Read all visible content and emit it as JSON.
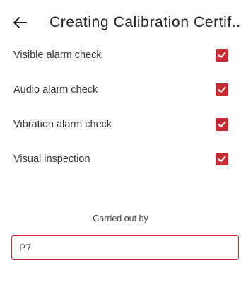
{
  "header": {
    "back_icon": "arrow-left-icon",
    "title": "Creating Calibration Certif..."
  },
  "checks": [
    {
      "label": "Visible alarm check",
      "checked": true
    },
    {
      "label": "Audio alarm check",
      "checked": true
    },
    {
      "label": "Vibration alarm check",
      "checked": true
    },
    {
      "label": "Visual inspection",
      "checked": true
    }
  ],
  "carried_out_by": {
    "label": "Carried out by",
    "value": "P7"
  },
  "colors": {
    "accent": "#c62b34",
    "checkmark": "#ffffff"
  }
}
